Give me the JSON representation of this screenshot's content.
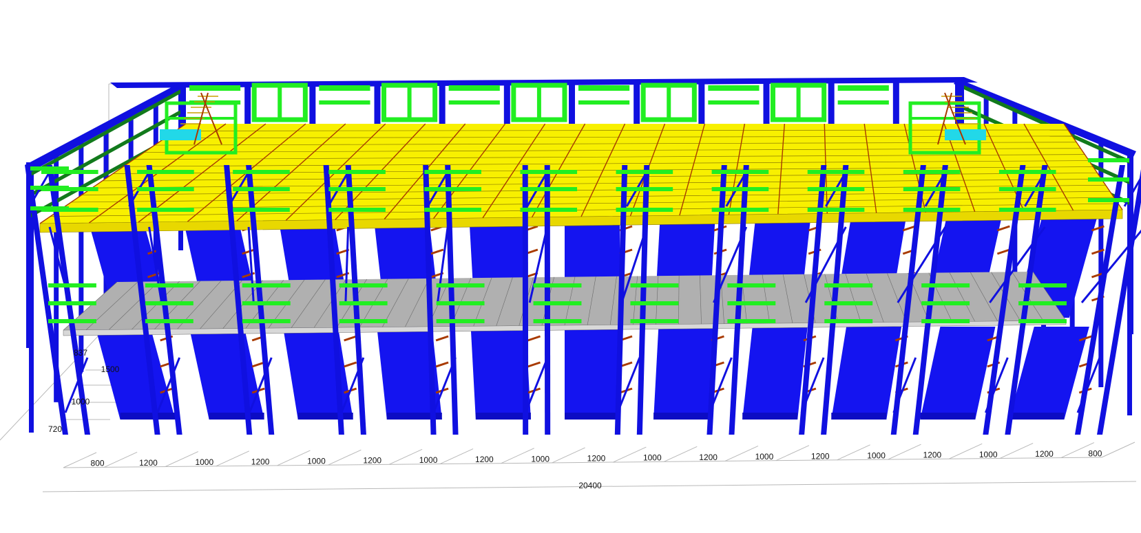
{
  "drawing": {
    "bay_dimensions": [
      "800",
      "1200",
      "1000",
      "1200",
      "1000",
      "1200",
      "1000",
      "1200",
      "1000",
      "1200",
      "1000",
      "1200",
      "1000",
      "1200",
      "1000",
      "1200",
      "1000",
      "1200",
      "800"
    ],
    "total_length": "20400",
    "height_dimensions": [
      "837",
      "1500",
      "1000",
      "720"
    ],
    "bay_count": 19
  },
  "colors": {
    "upright": "#1010e0",
    "upright_dark": "#0a0a9a",
    "panel": "#1414f0",
    "panel_shade": "#0c0cc4",
    "guardrail": "#22ee22",
    "guardrail_dark": "#127a1c",
    "deck": "#f8f000",
    "deck_line": "#8a7a00",
    "beam": "#a83a00",
    "mezzanine_floor": "#b0b0b0",
    "floor_line": "#6a6a6a",
    "stair": "#22d8e8",
    "dimension_line": "#b8b8b8"
  }
}
